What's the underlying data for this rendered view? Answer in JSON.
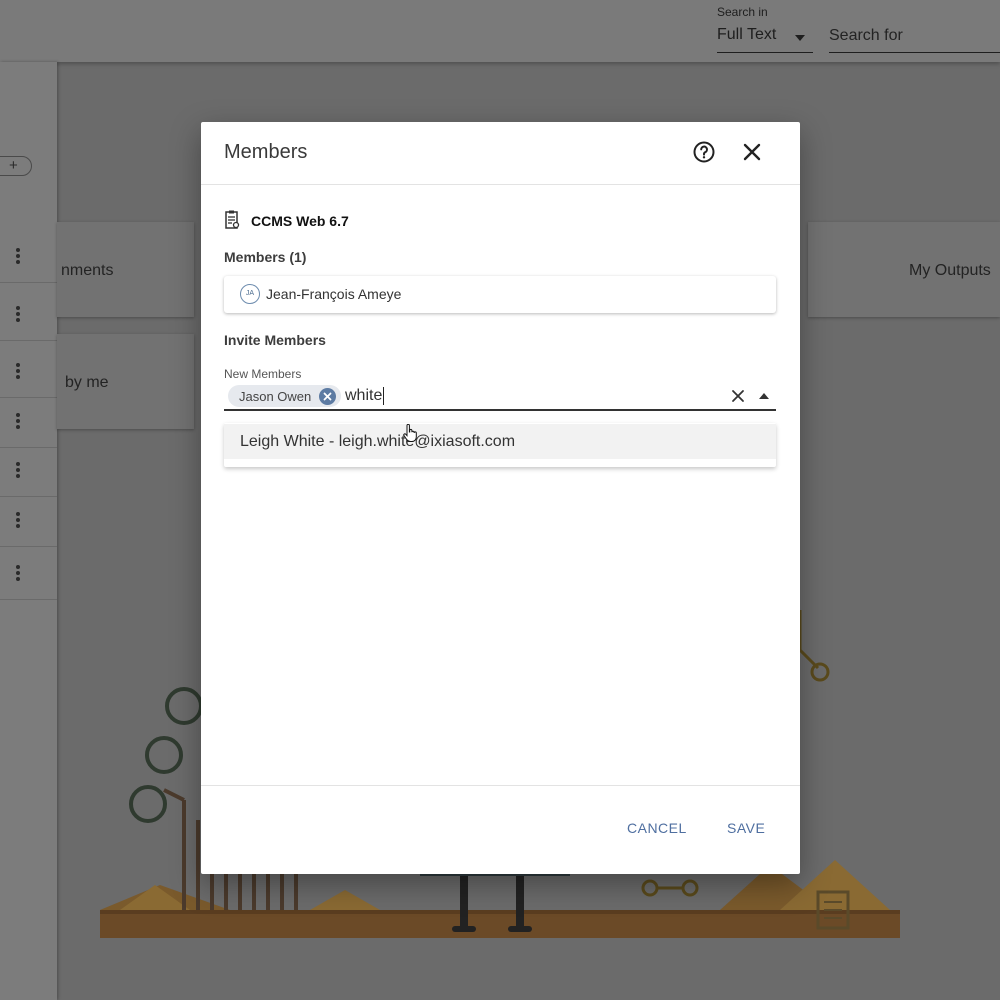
{
  "topbar": {
    "search_in_label": "Search in",
    "search_in_value": "Full Text",
    "search_for_placeholder": "Search for"
  },
  "sidebar": {
    "add_label": "+"
  },
  "background_cards": {
    "assignments_fragment": "nments",
    "by_me_fragment": "by me",
    "my_outputs": "My Outputs"
  },
  "dialog": {
    "title": "Members",
    "project_name": "CCMS Web 6.7",
    "members_heading": "Members (1)",
    "members": [
      {
        "initials": "JA",
        "name": "Jean-François Ameye"
      }
    ],
    "invite_heading": "Invite Members",
    "new_members_label": "New Members",
    "chips": [
      {
        "label": "Jason Owen"
      }
    ],
    "input_value": "white",
    "suggestions": [
      {
        "text": "Leigh White - leigh.white@ixiasoft.com"
      }
    ],
    "cancel_label": "CANCEL",
    "save_label": "SAVE"
  },
  "colors": {
    "accent": "#4f6fa0",
    "chip_bg": "#e6e9ee",
    "chip_remove": "#5d7ba3",
    "overlay": "#6b6b6b"
  },
  "icons": {
    "help": "help-circle-icon",
    "close": "close-icon",
    "project": "project-building-icon",
    "clear": "clear-icon",
    "dropdown": "caret-up-icon",
    "chip_remove": "remove-circle-icon",
    "cursor": "hand-cursor-icon"
  }
}
